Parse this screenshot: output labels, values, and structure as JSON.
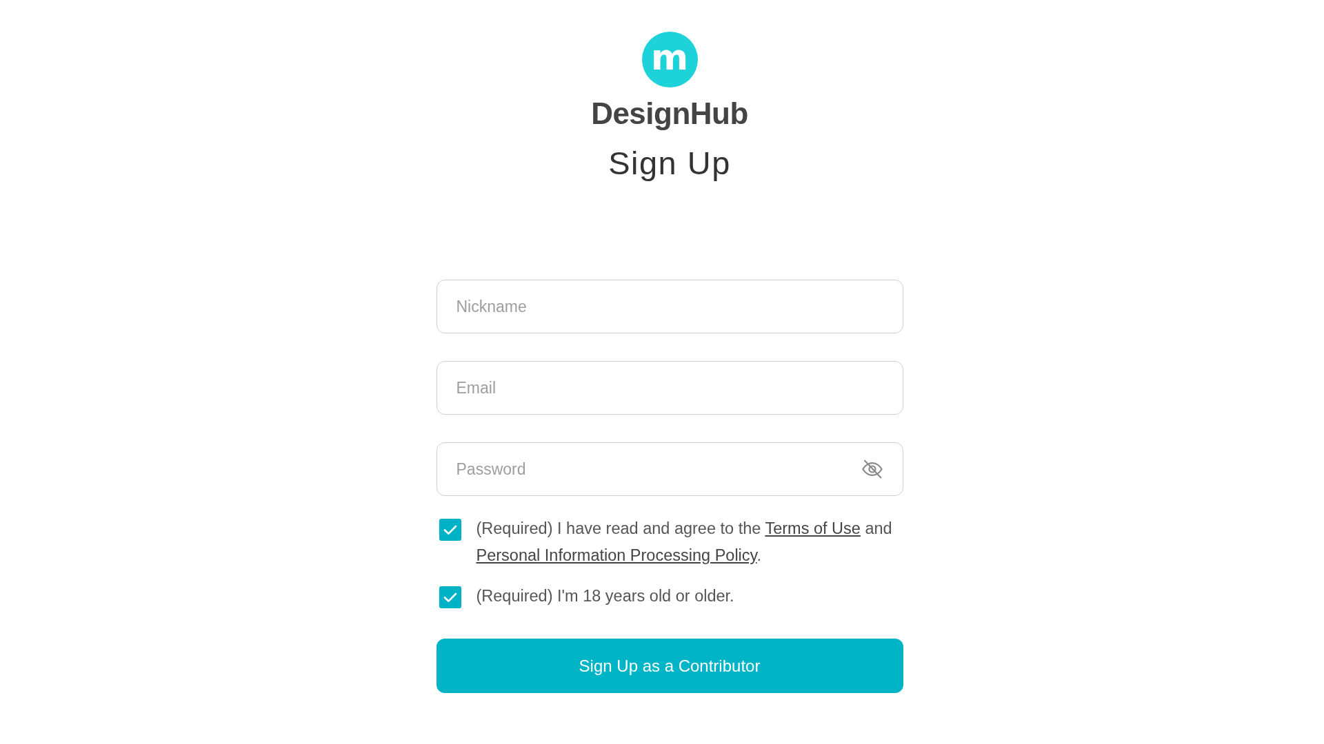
{
  "logo": {
    "mark": "m",
    "name": "DesignHub"
  },
  "title": "Sign Up",
  "fields": [
    {
      "kind": "text",
      "placeholder": "Nickname"
    },
    {
      "kind": "text",
      "placeholder": "Email"
    },
    {
      "kind": "password",
      "placeholder": "Password"
    }
  ],
  "agreements": [
    {
      "checked": true,
      "parts": [
        {
          "kind": "text",
          "text": "(Required) I have read and agree to the "
        },
        {
          "kind": "link",
          "text": "Terms of Use"
        },
        {
          "kind": "text",
          "text": " and "
        },
        {
          "kind": "link",
          "text": "Personal Information Processing Policy"
        },
        {
          "kind": "text",
          "text": "."
        }
      ]
    },
    {
      "checked": true,
      "parts": [
        {
          "kind": "text",
          "text": "(Required) I'm 18 years old or older."
        }
      ]
    }
  ],
  "submit_button": "Sign Up as a Contributor"
}
